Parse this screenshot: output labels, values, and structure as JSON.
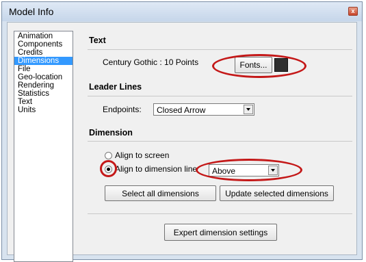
{
  "window": {
    "title": "Model Info",
    "close_glyph": "x"
  },
  "sidebar": {
    "items": [
      {
        "label": "Animation",
        "selected": false
      },
      {
        "label": "Components",
        "selected": false
      },
      {
        "label": "Credits",
        "selected": false
      },
      {
        "label": "Dimensions",
        "selected": true
      },
      {
        "label": "File",
        "selected": false
      },
      {
        "label": "Geo-location",
        "selected": false
      },
      {
        "label": "Rendering",
        "selected": false
      },
      {
        "label": "Statistics",
        "selected": false
      },
      {
        "label": "Text",
        "selected": false
      },
      {
        "label": "Units",
        "selected": false
      }
    ]
  },
  "text_section": {
    "heading": "Text",
    "font_description": "Century Gothic : 10 Points",
    "fonts_button": "Fonts...",
    "color_swatch": "#2f2f2f"
  },
  "leader_lines": {
    "heading": "Leader Lines",
    "endpoints_label": "Endpoints:",
    "endpoints_value": "Closed Arrow"
  },
  "dimension": {
    "heading": "Dimension",
    "align_screen_label": "Align to screen",
    "align_screen_selected": false,
    "align_line_label": "Align to dimension line",
    "align_line_selected": true,
    "position_value": "Above",
    "select_all_button": "Select all dimensions",
    "update_selected_button": "Update selected dimensions",
    "expert_button": "Expert dimension settings"
  },
  "annotation_color": "#c41818"
}
